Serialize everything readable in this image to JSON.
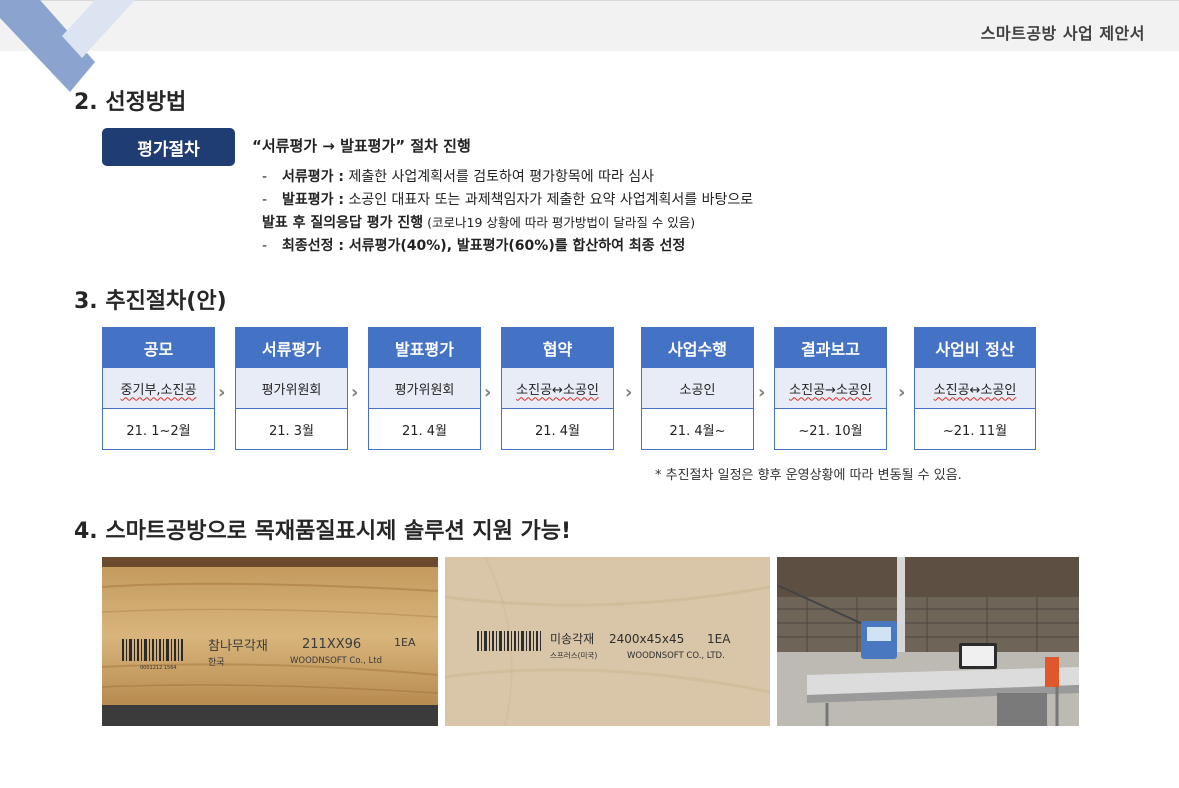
{
  "header": {
    "doc_title": "스마트공방 사업 제안서"
  },
  "section2": {
    "title": "2. 선정방법",
    "badge": "평가절차",
    "heading": "“서류평가 → 발표평가” 절차 진행",
    "line1": {
      "label": "서류평가 :",
      "text": " 제출한 사업계획서를 검토하여 평가항목에 따라 심사"
    },
    "line2": {
      "label": "발표평가 :",
      "text": " 소공인 대표자 또는 과제책임자가 제출한 요약 사업계획서를 바탕으로"
    },
    "line3": {
      "text": "발표 후 질의응답 평가 진행",
      "note": " (코로나19 상황에 따라 평가방법이 달라질 수 있음)"
    },
    "line4": {
      "label": "최종선정 :",
      "text": " 서류평가(40%), 발표평가(60%)를 합산하여 최종 선정"
    }
  },
  "section3": {
    "title": "3. 추진절차(안)",
    "steps": [
      {
        "head": "공모",
        "who": "중기부,소진공",
        "when": "21. 1~2월"
      },
      {
        "head": "서류평가",
        "who": "평가위원회",
        "when": "21. 3월"
      },
      {
        "head": "발표평가",
        "who": "평가위원회",
        "when": "21. 4월"
      },
      {
        "head": "협약",
        "who": "소진공↔소공인",
        "when": "21. 4월"
      },
      {
        "head": "사업수행",
        "who": "소공인",
        "when": "21. 4월~"
      },
      {
        "head": "결과보고",
        "who": "소진공→소공인",
        "when": "~21. 10월"
      },
      {
        "head": "사업비 정산",
        "who": "소진공↔소공인",
        "when": "~21. 11월"
      }
    ],
    "note": "* 추진절차 일정은 향후 운영상황에 따라 변동될 수 있음."
  },
  "section4": {
    "title": "4. 스마트공방으로 목재품질표시제 솔루션 지원 가능!",
    "photo1": {
      "product": "참나무각재",
      "size": "211XX96",
      "qty": "1EA",
      "origin": "한국",
      "maker": "WOODNSOFT Co., Ltd",
      "code": "0001212 1564"
    },
    "photo2": {
      "product": "미송각재",
      "size": "2400x45x45",
      "qty": "1EA",
      "origin": "스프러스(미국)",
      "maker": "WOODNSOFT CO., LTD."
    }
  },
  "colors": {
    "navy": "#1f3d73",
    "step_blue": "#4472c4",
    "step_light": "#e8ecf6"
  }
}
